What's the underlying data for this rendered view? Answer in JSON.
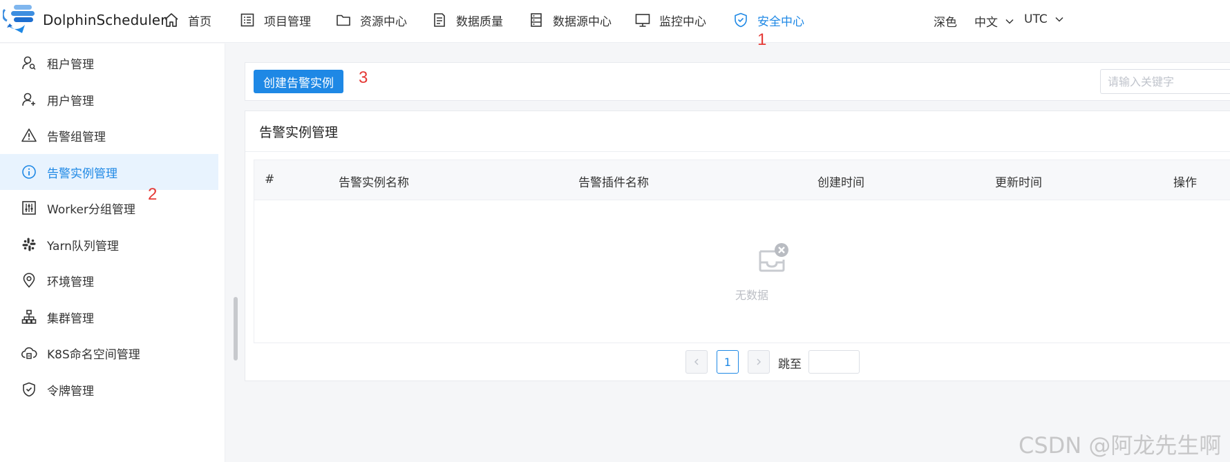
{
  "app": {
    "brand": "DolphinScheduler"
  },
  "nav": {
    "items": [
      {
        "label": "首页",
        "icon": "home-icon"
      },
      {
        "label": "项目管理",
        "icon": "project-icon"
      },
      {
        "label": "资源中心",
        "icon": "folder-icon"
      },
      {
        "label": "数据质量",
        "icon": "data-quality-icon"
      },
      {
        "label": "数据源中心",
        "icon": "datasource-icon"
      },
      {
        "label": "监控中心",
        "icon": "monitor-icon"
      },
      {
        "label": "安全中心",
        "icon": "shield-icon"
      }
    ],
    "active": "安全中心",
    "theme_label": "深色",
    "language_label": "中文",
    "timezone_label": "UTC"
  },
  "annotations": {
    "one": "1",
    "two": "2",
    "three": "3"
  },
  "sidebar": {
    "items": [
      {
        "label": "租户管理",
        "icon": "tenant-icon"
      },
      {
        "label": "用户管理",
        "icon": "user-icon"
      },
      {
        "label": "告警组管理",
        "icon": "warning-icon"
      },
      {
        "label": "告警实例管理",
        "icon": "info-icon"
      },
      {
        "label": "Worker分组管理",
        "icon": "sliders-icon"
      },
      {
        "label": "Yarn队列管理",
        "icon": "slack-icon"
      },
      {
        "label": "环境管理",
        "icon": "location-icon"
      },
      {
        "label": "集群管理",
        "icon": "cluster-icon"
      },
      {
        "label": "K8S命名空间管理",
        "icon": "cloud-icon"
      },
      {
        "label": "令牌管理",
        "icon": "token-shield-icon"
      }
    ],
    "active": "告警实例管理"
  },
  "toolbar": {
    "create_label": "创建告警实例",
    "search_placeholder": "请输入关键字"
  },
  "card": {
    "title": "告警实例管理",
    "table": {
      "columns": [
        "#",
        "告警实例名称",
        "告警插件名称",
        "创建时间",
        "更新时间",
        "操作"
      ],
      "rows": [],
      "empty_text": "无数据"
    }
  },
  "pagination": {
    "current_page": "1",
    "jump_label": "跳至"
  },
  "watermark": "CSDN @阿龙先生啊",
  "colors": {
    "accent": "#1e88e5",
    "annotation": "#e53935",
    "active_bg": "#e8f3fe"
  }
}
